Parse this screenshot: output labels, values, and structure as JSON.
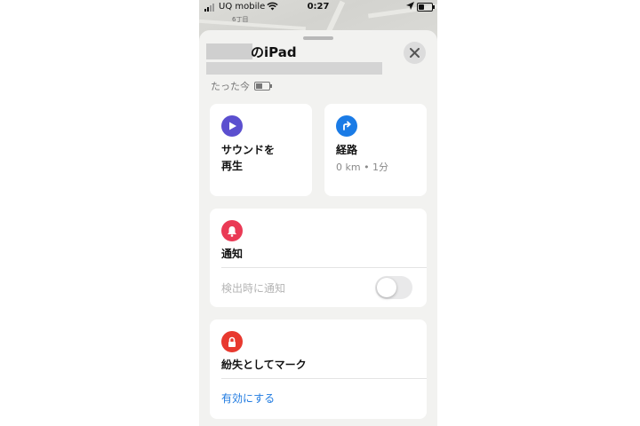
{
  "status_bar": {
    "carrier": "UQ mobile",
    "time": "0:27"
  },
  "map": {
    "label": "6丁目"
  },
  "sheet": {
    "title_suffix": "のiPad",
    "last_seen": "たった今"
  },
  "actions": {
    "play_sound": {
      "line1": "サウンドを",
      "line2": "再生",
      "color": "#5b4fcf"
    },
    "directions": {
      "label": "経路",
      "distance": "0 km • 1分",
      "color": "#1a7be6"
    }
  },
  "notifications": {
    "title": "通知",
    "notify_when_found": "検出時に通知",
    "toggle_on": false,
    "color": "#ea3a55"
  },
  "lost_mode": {
    "title": "紛失としてマーク",
    "enable": "有効にする",
    "color": "#e8392f"
  }
}
